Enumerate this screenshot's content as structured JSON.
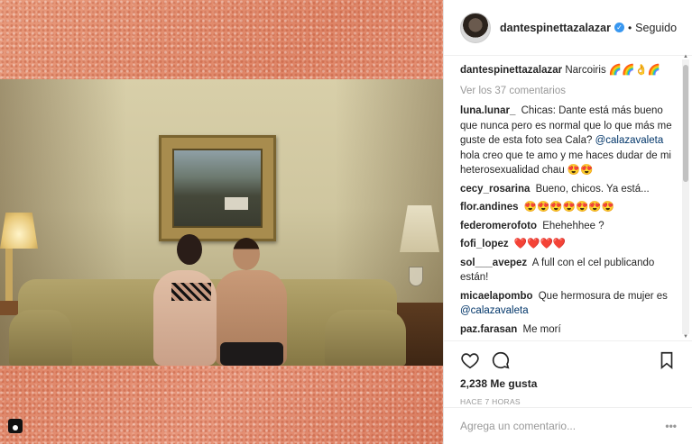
{
  "header": {
    "username": "dantespinettazalazar",
    "verified_icon": "verified-badge-icon",
    "separator": "•",
    "follow_status": "Seguido"
  },
  "caption": {
    "username": "dantespinettazalazar",
    "text": "Narcoiris 🌈🌈👌🌈"
  },
  "view_comments": "Ver los 37 comentarios",
  "comments": [
    {
      "user": "luna.lunar_",
      "text": "Chicas: Dante está más bueno que nunca pero es normal que lo que más me guste de esta foto sea Cala?"
    },
    {
      "user": "",
      "mention": "@calazavaleta",
      "text": "hola creo que te amo y me haces dudar de mi heterosexualidad chau 😍😍"
    },
    {
      "user": "cecy_rosarina",
      "text": "Bueno, chicos. Ya está..."
    },
    {
      "user": "flor.andines",
      "text": "😍😍😍😍😍😍😍"
    },
    {
      "user": "federomerofoto",
      "text": "Ehehehhee ?"
    },
    {
      "user": "fofi_lopez",
      "text": "❤️❤️❤️❤️"
    },
    {
      "user": "sol___avepez",
      "text": "A full con el cel publicando están!"
    },
    {
      "user": "micaelapombo",
      "text": "Que hermosura de mujer es",
      "mention": "@calazavaleta"
    },
    {
      "user": "paz.farasan",
      "text": "Me morí"
    }
  ],
  "actions": {
    "like_icon": "heart-icon",
    "comment_icon": "comment-icon",
    "save_icon": "bookmark-icon"
  },
  "likes": "2,238 Me gusta",
  "timestamp": "HACE 7 HORAS",
  "add_comment": {
    "placeholder": "Agrega un comentario...",
    "more_label": "•••"
  }
}
